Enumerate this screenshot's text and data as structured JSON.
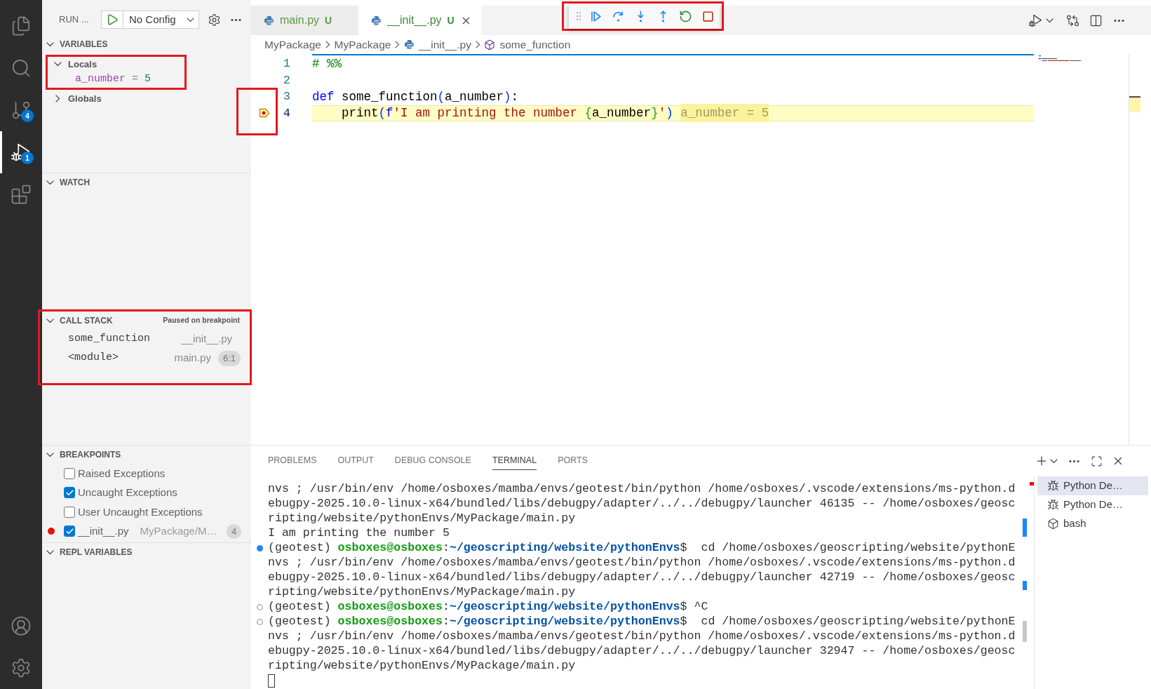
{
  "activity_bar": {
    "items": [
      {
        "kind": "explorer",
        "selected": false
      },
      {
        "kind": "search",
        "selected": false
      },
      {
        "kind": "source_control",
        "selected": false,
        "badge": "4"
      },
      {
        "kind": "run_debug",
        "selected": true,
        "badge": "1"
      },
      {
        "kind": "extensions",
        "selected": false
      }
    ],
    "bottom_items": [
      {
        "kind": "accounts"
      },
      {
        "kind": "manage"
      }
    ]
  },
  "sidebar": {
    "title": "RUN ...",
    "configuration": "No Config",
    "variables": {
      "title": "VARIABLES",
      "expanded": true,
      "scopes": [
        {
          "name": "Locals",
          "expanded": true,
          "highlighted": true,
          "variables": [
            {
              "name": "a_number",
              "separator": "=",
              "value": "5"
            }
          ]
        },
        {
          "name": "Globals",
          "expanded": false,
          "highlighted": false
        }
      ]
    },
    "watch": {
      "title": "WATCH",
      "expanded": true
    },
    "call_stack": {
      "title": "CALL STACK",
      "expanded": true,
      "status": "Paused on breakpoint",
      "highlighted": true,
      "frames": [
        {
          "name": "some_function",
          "file": "__init__.py"
        },
        {
          "name": "<module>",
          "file": "main.py",
          "position": "6:1"
        }
      ]
    },
    "breakpoints": {
      "title": "BREAKPOINTS",
      "expanded": true,
      "items": [
        {
          "kind": "exception",
          "label": "Raised Exceptions",
          "checked": false
        },
        {
          "kind": "exception",
          "label": "Uncaught Exceptions",
          "checked": true
        },
        {
          "kind": "exception",
          "label": "User Uncaught Exceptions",
          "checked": false
        },
        {
          "kind": "file",
          "label": "__init__.py",
          "path": "MyPackage/M…",
          "count": "4",
          "checked": true
        }
      ]
    },
    "repl_variables": {
      "title": "REPL VARIABLES",
      "expanded": true
    }
  },
  "editor": {
    "tabs": [
      {
        "label": "main.py",
        "status": "U",
        "selected": false
      },
      {
        "label": "__init__.py",
        "status": "U",
        "selected": true
      }
    ],
    "debug_toolbar": {
      "highlighted": true
    },
    "breadcrumbs": [
      {
        "kind": "folder",
        "label": "MyPackage"
      },
      {
        "kind": "folder",
        "label": "MyPackage"
      },
      {
        "kind": "python_file",
        "label": "__init__.py"
      },
      {
        "kind": "symbol",
        "label": "some_function"
      }
    ],
    "lines": [
      {
        "number": "1",
        "paused": false,
        "highlighted": false,
        "tokens": [
          {
            "kind": "comment",
            "text": "# %%"
          }
        ]
      },
      {
        "number": "2",
        "paused": false,
        "highlighted": false
      },
      {
        "number": "3",
        "paused": false,
        "highlighted": false,
        "tokens": [
          {
            "kind": "keyword",
            "text": "def"
          },
          {
            "kind": "plain",
            "text": " some_function"
          },
          {
            "kind": "bracket1",
            "text": "("
          },
          {
            "kind": "plain",
            "text": "a_number"
          },
          {
            "kind": "bracket1",
            "text": ")"
          },
          {
            "kind": "plain",
            "text": ":"
          }
        ]
      },
      {
        "number": "4",
        "paused": true,
        "highlighted": true,
        "tokens": [
          {
            "kind": "plain",
            "text": "    print"
          },
          {
            "kind": "bracket1",
            "text": "("
          },
          {
            "kind": "keyword",
            "text": "f"
          },
          {
            "kind": "string",
            "text": "'I am printing the number "
          },
          {
            "kind": "bracket2",
            "text": "{"
          },
          {
            "kind": "plain",
            "text": "a_number"
          },
          {
            "kind": "bracket2",
            "text": "}"
          },
          {
            "kind": "string",
            "text": "'"
          },
          {
            "kind": "bracket1",
            "text": ")"
          }
        ],
        "inline_value": "a_number = 5"
      }
    ]
  },
  "panel": {
    "tabs": [
      {
        "label": "PROBLEMS",
        "selected": false
      },
      {
        "label": "OUTPUT",
        "selected": false
      },
      {
        "label": "DEBUG CONSOLE",
        "selected": false
      },
      {
        "label": "TERMINAL",
        "selected": true
      },
      {
        "label": "PORTS",
        "selected": false
      }
    ],
    "terminal": {
      "lines": [
        {
          "kind": "output",
          "text": "nvs ; /usr/bin/env /home/osboxes/mamba/envs/geotest/bin/python /home/osboxes/.vscode/extensions/ms-python.d"
        },
        {
          "kind": "output",
          "text": "ebugpy-2025.10.0-linux-x64/bundled/libs/debugpy/adapter/../../debugpy/launcher 46135 -- /home/osboxes/geosc"
        },
        {
          "kind": "output",
          "text": "ripting/website/pythonEnvs/MyPackage/main.py"
        },
        {
          "kind": "output",
          "text": "I am printing the number 5"
        },
        {
          "kind": "success",
          "segments": [
            {
              "kind": "plain",
              "text": "(geotest) "
            },
            {
              "kind": "user",
              "text": "osboxes@osboxes"
            },
            {
              "kind": "plain",
              "text": ":"
            },
            {
              "kind": "path",
              "text": "~/geoscripting/website/pythonEnvs"
            },
            {
              "kind": "plain",
              "text": "$  cd /home/osboxes/geoscripting/website/pythonE"
            }
          ]
        },
        {
          "kind": "output",
          "text": "nvs ; /usr/bin/env /home/osboxes/mamba/envs/geotest/bin/python /home/osboxes/.vscode/extensions/ms-python.d"
        },
        {
          "kind": "output",
          "text": "ebugpy-2025.10.0-linux-x64/bundled/libs/debugpy/adapter/../../debugpy/launcher 42719 -- /home/osboxes/geosc"
        },
        {
          "kind": "output",
          "text": "ripting/website/pythonEnvs/MyPackage/main.py"
        },
        {
          "kind": "neutral",
          "segments": [
            {
              "kind": "plain",
              "text": "(geotest) "
            },
            {
              "kind": "user",
              "text": "osboxes@osboxes"
            },
            {
              "kind": "plain",
              "text": ":"
            },
            {
              "kind": "path",
              "text": "~/geoscripting/website/pythonEnvs"
            },
            {
              "kind": "plain",
              "text": "$ ^C"
            }
          ]
        },
        {
          "kind": "neutral",
          "segments": [
            {
              "kind": "plain",
              "text": "(geotest) "
            },
            {
              "kind": "user",
              "text": "osboxes@osboxes"
            },
            {
              "kind": "plain",
              "text": ":"
            },
            {
              "kind": "path",
              "text": "~/geoscripting/website/pythonEnvs"
            },
            {
              "kind": "plain",
              "text": "$  cd /home/osboxes/geoscripting/website/pythonE"
            }
          ]
        },
        {
          "kind": "output",
          "text": "nvs ; /usr/bin/env /home/osboxes/mamba/envs/geotest/bin/python /home/osboxes/.vscode/extensions/ms-python.d"
        },
        {
          "kind": "output",
          "text": "ebugpy-2025.10.0-linux-x64/bundled/libs/debugpy/adapter/../../debugpy/launcher 32947 -- /home/osboxes/geosc"
        },
        {
          "kind": "output",
          "text": "ripting/website/pythonEnvs/MyPackage/main.py"
        }
      ]
    },
    "terminals": [
      {
        "kind": "debug",
        "label": "Python De…",
        "selected": true
      },
      {
        "kind": "debug",
        "label": "Python De…",
        "selected": false
      },
      {
        "kind": "shell",
        "label": "bash",
        "selected": false
      }
    ]
  }
}
